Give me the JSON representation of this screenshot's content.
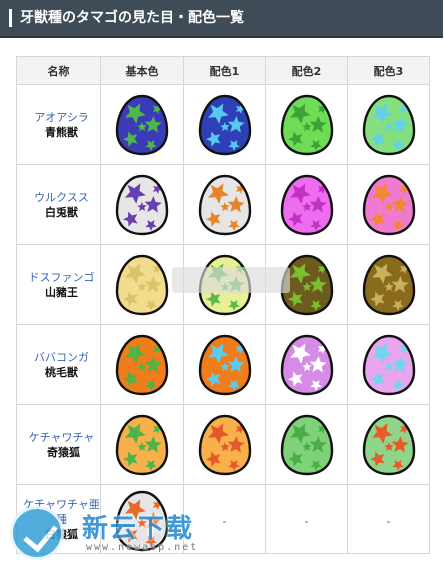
{
  "header": {
    "title": "牙獣種のタマゴの見た目・配色一覧"
  },
  "table": {
    "columns": [
      "名称",
      "基本色",
      "配色1",
      "配色2",
      "配色3"
    ],
    "rows": [
      {
        "kana": "アオアシラ",
        "kanji": "青熊獣",
        "eggs": [
          {
            "shell": "#3b3bb8",
            "spots": "#4fb84a"
          },
          {
            "shell": "#2f3fb5",
            "spots": "#57c8ee"
          },
          {
            "shell": "#6fdc58",
            "spots": "#3ea336"
          },
          {
            "shell": "#86df7e",
            "spots": "#62d1e8"
          }
        ]
      },
      {
        "kana": "ウルクスス",
        "kanji": "白兎獣",
        "eggs": [
          {
            "shell": "#e6e6e6",
            "spots": "#6a3fb0"
          },
          {
            "shell": "#e6e6e6",
            "spots": "#e8842a"
          },
          {
            "shell": "#ee6cf0",
            "spots": "#c031c4"
          },
          {
            "shell": "#f07ad0",
            "spots": "#f1882e"
          }
        ]
      },
      {
        "kana": "ドスファンゴ",
        "kanji": "山豬王",
        "eggs": [
          {
            "shell": "#f2dd8e",
            "spots": "#d9c36b"
          },
          {
            "shell": "#e8ef95",
            "spots": "#59b84e"
          },
          {
            "shell": "#6c5a1e",
            "spots": "#7bbf2e"
          },
          {
            "shell": "#8a6a1c",
            "spots": "#c8b15a"
          }
        ]
      },
      {
        "kana": "ババコンガ",
        "kanji": "桃毛獣",
        "eggs": [
          {
            "shell": "#f07d1a",
            "spots": "#53b242"
          },
          {
            "shell": "#f07d1a",
            "spots": "#5ccbee"
          },
          {
            "shell": "#d68be6",
            "spots": "#ffffff"
          },
          {
            "shell": "#e9a6ee",
            "spots": "#6fd6ee"
          }
        ]
      },
      {
        "kana": "ケチャワチャ",
        "kanji": "奇猿狐",
        "eggs": [
          {
            "shell": "#f7b04a",
            "spots": "#4db44a"
          },
          {
            "shell": "#f7b04a",
            "spots": "#e3592a"
          },
          {
            "shell": "#7fd27a",
            "spots": "#4aad45"
          },
          {
            "shell": "#8fd58a",
            "spots": "#e8592c"
          }
        ]
      },
      {
        "kana": "ケチャワチャ亜種",
        "kanji": "白猿狐",
        "eggs": [
          {
            "shell": "#e6e6e6",
            "spots": "#e86a28"
          }
        ],
        "dashes": [
          "-",
          "-",
          "-"
        ]
      }
    ]
  },
  "watermark": {
    "text": "新云下载",
    "url": "www.newasp.net"
  },
  "colors": {
    "header_bg": "#3f4b57",
    "link": "#3a66b3",
    "border": "#d6d6d6"
  }
}
